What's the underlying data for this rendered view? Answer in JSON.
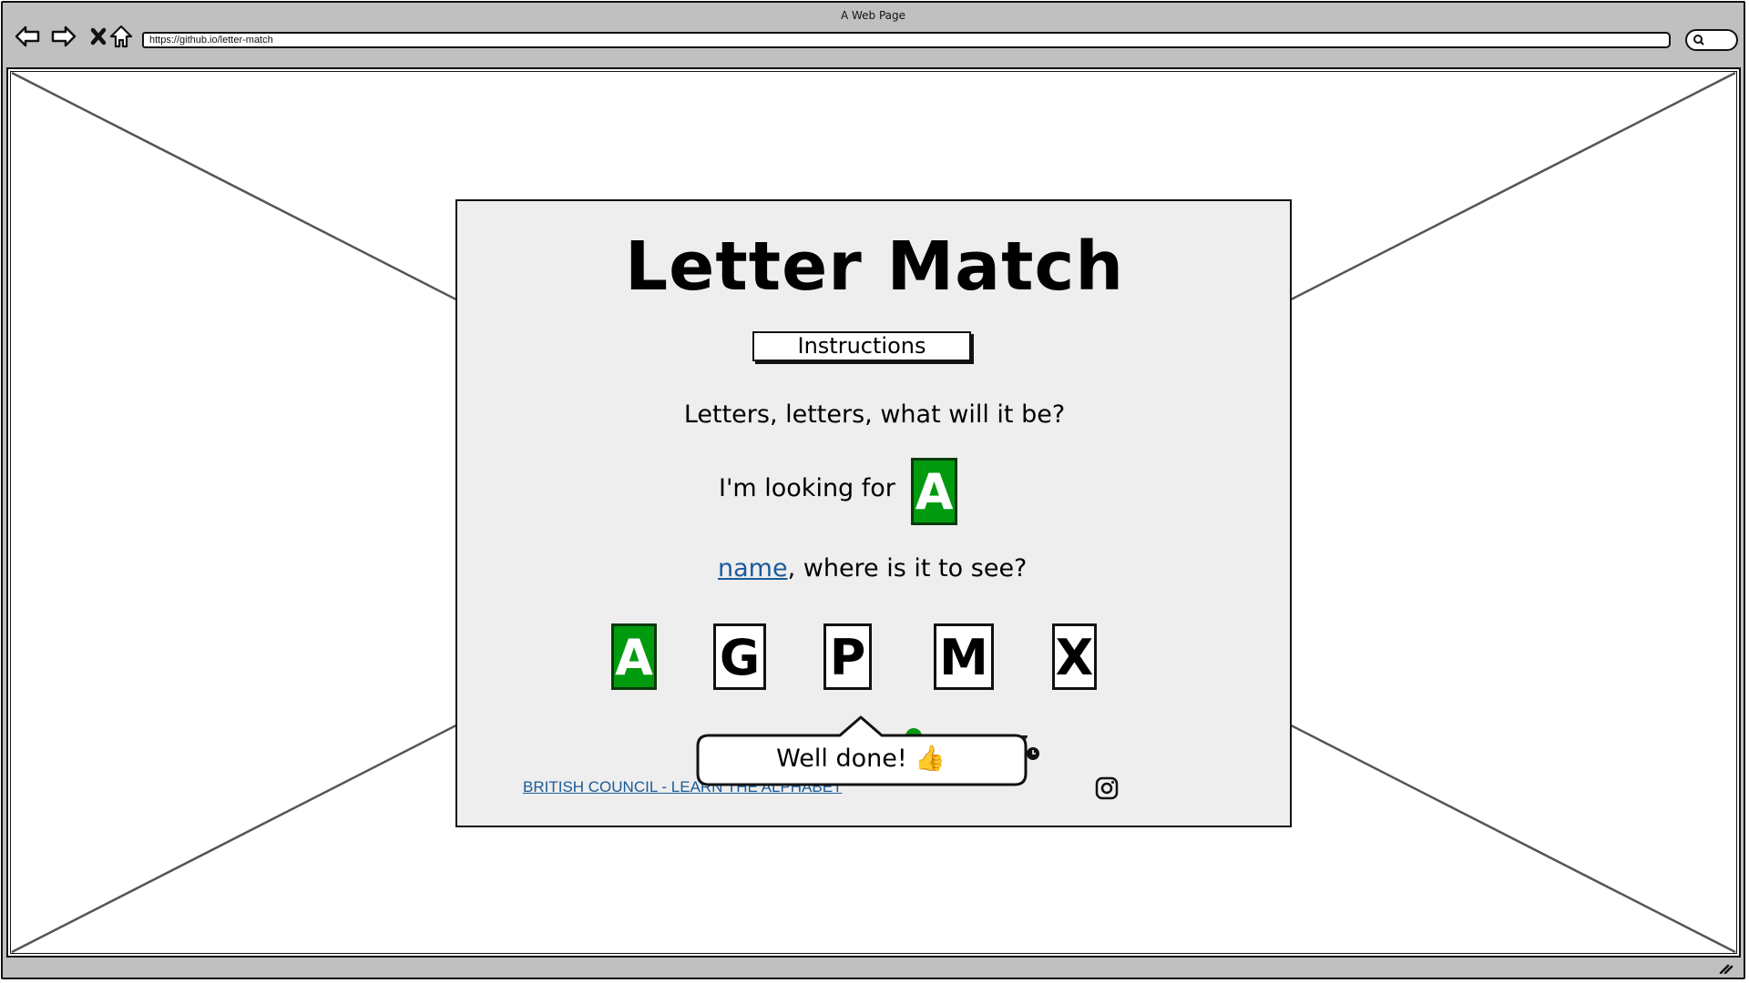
{
  "browser": {
    "window_title": "A Web Page",
    "url": "https://github.io/letter-match",
    "nav": [
      "back-icon",
      "forward-icon",
      "stop-icon",
      "home-icon"
    ],
    "search_icon": "search-icon"
  },
  "game": {
    "title": "Letter Match",
    "instructions_label": "Instructions",
    "riddle_line_1": "Letters, letters, what will it be?",
    "looking_for_label": "I'm looking for",
    "target_letter": "A",
    "name_link": "name",
    "riddle_line_2_rest": ", where is it to see?",
    "choices": [
      {
        "letter": "A",
        "state": "correct"
      },
      {
        "letter": "G",
        "state": "default"
      },
      {
        "letter": "P",
        "state": "default"
      },
      {
        "letter": "M",
        "state": "default"
      },
      {
        "letter": "X",
        "state": "default"
      }
    ],
    "feedback": "Well done! 👍"
  },
  "footer": {
    "link_label": "BRITISH COUNCIL - LEARN THE ALPHABET",
    "social_icon": "instagram-icon"
  },
  "colors": {
    "correct_green": "#009a0e",
    "link_blue": "#1a5a9a",
    "panel_bg": "#eeeeee",
    "chrome_gray": "#c0c0c0"
  }
}
